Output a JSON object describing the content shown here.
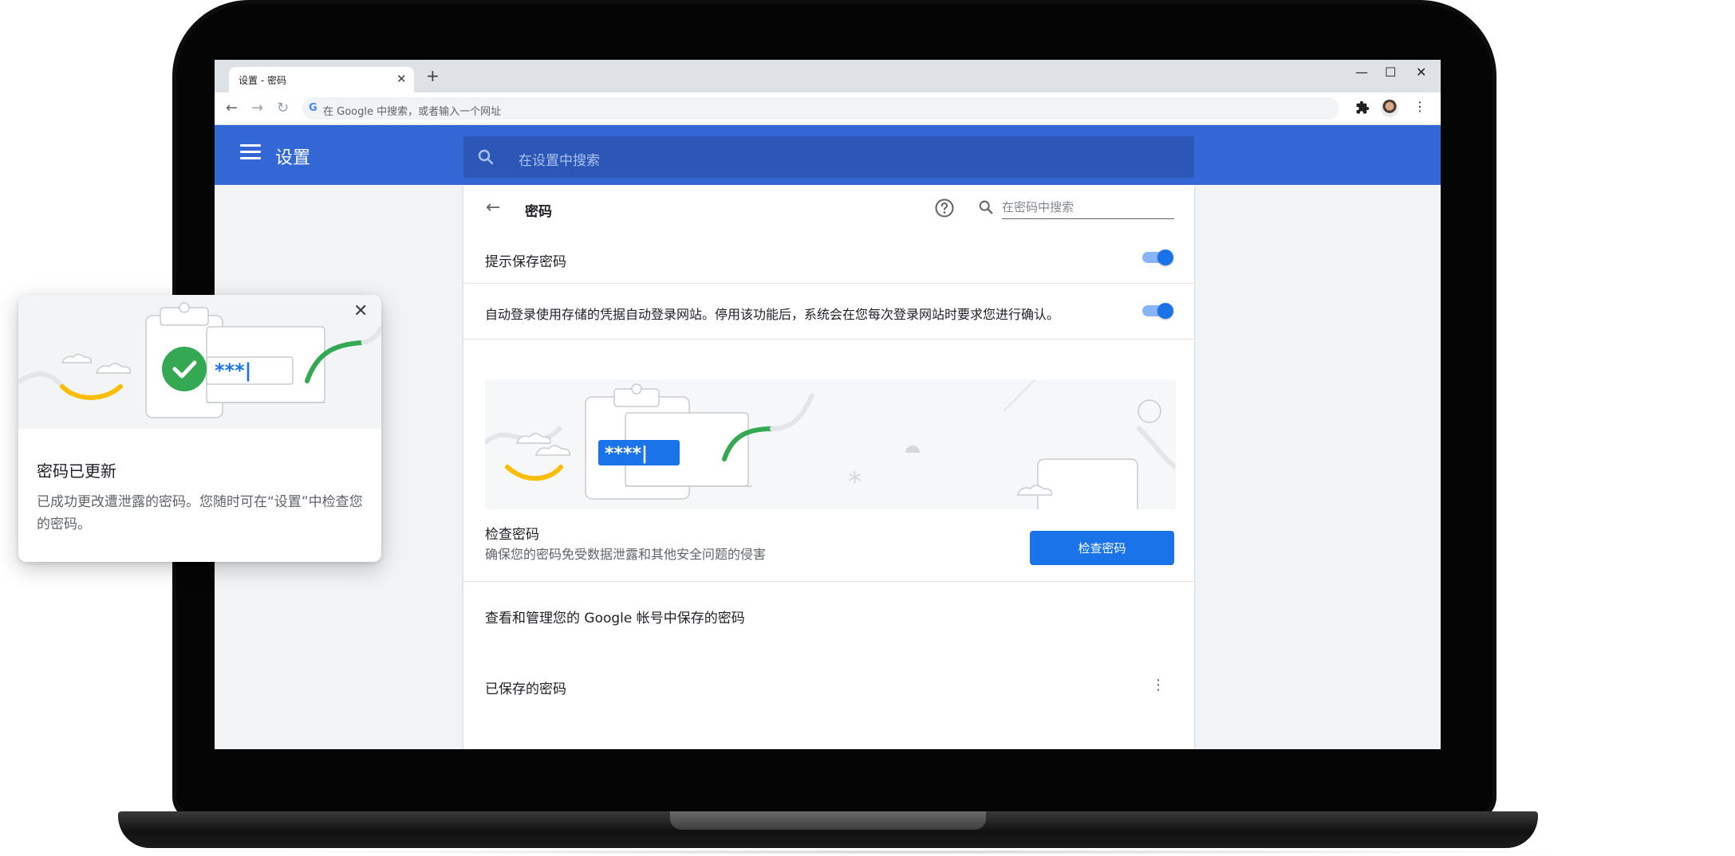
{
  "browser": {
    "tab_title": "设置 - 密码",
    "tab_close": "✕",
    "new_tab": "+",
    "window_controls": {
      "minimize": "—",
      "maximize": "☐",
      "close": "✕"
    },
    "nav": {
      "back": "←",
      "forward": "→",
      "reload": "↻"
    },
    "omnibox_g": "G",
    "omnibox_placeholder": "在 Google 中搜索，或者输入一个网址",
    "extension_icon": "puzzle-icon",
    "menu": "⋮"
  },
  "settings": {
    "title": "设置",
    "search_placeholder": "在设置中搜索"
  },
  "passwords": {
    "back": "←",
    "title": "密码",
    "search_placeholder": "在密码中搜索",
    "offer_to_save": {
      "label": "提示保存密码",
      "enabled": true
    },
    "auto_signin": {
      "label": "自动登录使用存储的凭据自动登录网站。停用该功能后，系统会在您每次登录网站时要求您进行确认。",
      "enabled": true
    },
    "illustration_password": "****|",
    "check": {
      "title": "检查密码",
      "description": "确保您的密码免受数据泄露和其他安全问题的侵害",
      "button": "检查密码"
    },
    "google_account_link": "查看和管理您的 Google 帐号中保存的密码",
    "saved_title": "已保存的密码",
    "saved_menu": "⋮"
  },
  "notification": {
    "close": "✕",
    "illustration_password": "***|",
    "title": "密码已更新",
    "body": "已成功更改遭泄露的密码。您随时可在“设置”中检查您的密码。"
  },
  "colors": {
    "accent": "#1a73e8",
    "appbar": "#3367d6",
    "success": "#34a853",
    "yellow": "#fbbc04"
  }
}
